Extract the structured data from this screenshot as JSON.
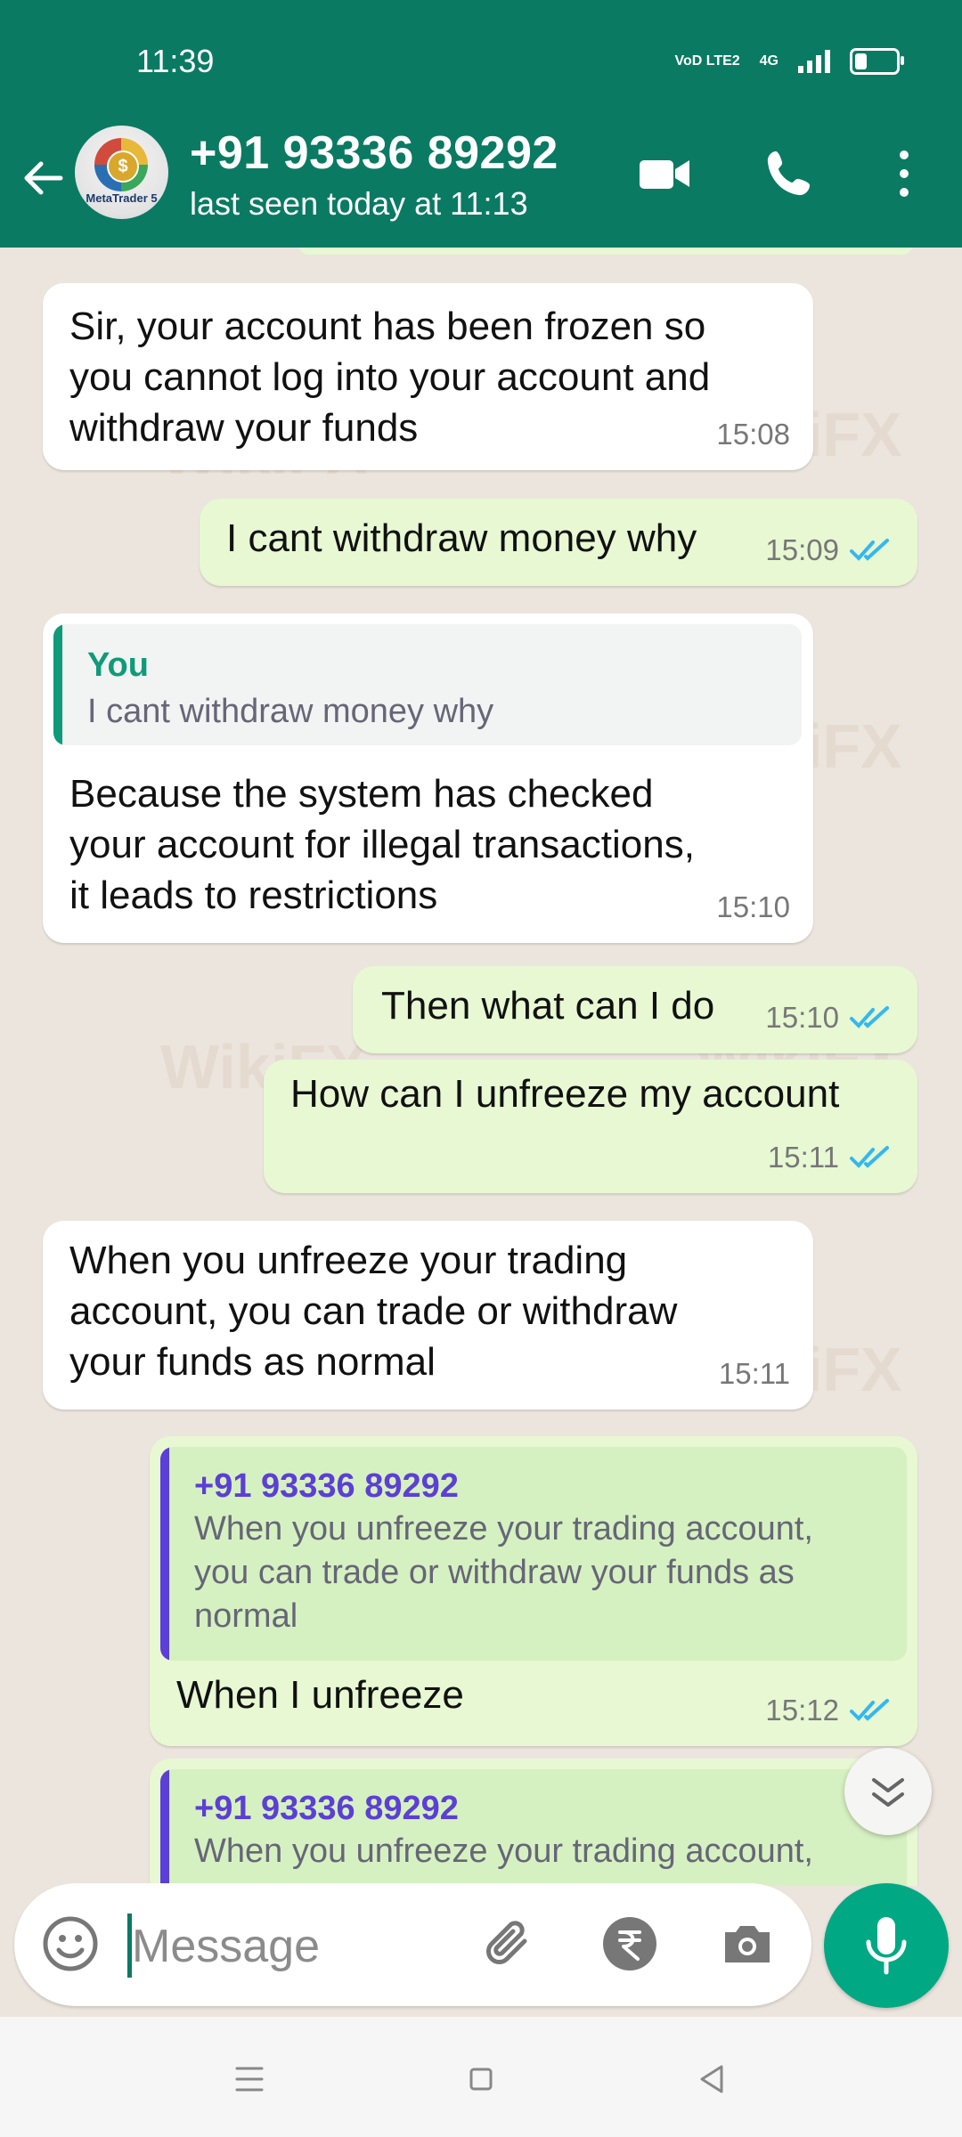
{
  "status_bar": {
    "time": "11:39",
    "network_label_1": "VoD LTE2",
    "network_label_2": "4G",
    "battery_fraction": 0.3
  },
  "header": {
    "contact_name": "+91 93336 89292",
    "last_seen": "last seen today at 11:13",
    "avatar_label": "MetaTrader 5",
    "icons": [
      "back-arrow-icon",
      "video-call-icon",
      "voice-call-icon",
      "more-options-icon"
    ]
  },
  "messages": [
    {
      "direction": "in",
      "text_lines": [
        "Sir, your account has been frozen so",
        "you cannot log into your account and",
        "withdraw your funds"
      ],
      "time": "15:08"
    },
    {
      "direction": "out",
      "text_lines": [
        "I cant withdraw money why"
      ],
      "time": "15:09",
      "status": "read"
    },
    {
      "direction": "in",
      "quote": {
        "author": "You",
        "text_lines": [
          "I cant withdraw money why"
        ]
      },
      "text_lines": [
        "Because the system has checked",
        "your account for illegal transactions,",
        "it leads to restrictions"
      ],
      "time": "15:10"
    },
    {
      "direction": "out",
      "text_lines": [
        "Then what can I do"
      ],
      "time": "15:10",
      "status": "read"
    },
    {
      "direction": "out",
      "text_lines": [
        "How can I unfreeze my account"
      ],
      "time": "15:11",
      "status": "read"
    },
    {
      "direction": "in",
      "text_lines": [
        "When you unfreeze your trading",
        "account, you can trade or withdraw",
        "your funds as normal"
      ],
      "time": "15:11"
    },
    {
      "direction": "out",
      "quote": {
        "author": "+91 93336 89292",
        "text_lines": [
          "When you unfreeze your trading account,",
          "you can trade or withdraw your funds as",
          "normal"
        ]
      },
      "text_lines": [
        "When I unfreeze"
      ],
      "time": "15:12",
      "status": "read"
    },
    {
      "direction": "out",
      "quote": {
        "author": "+91 93336 89292",
        "text_lines": [
          "When you unfreeze your trading account,"
        ]
      },
      "text_lines": [],
      "time": ""
    }
  ],
  "composer": {
    "placeholder": "Message",
    "icons": [
      "emoji-icon",
      "attach-icon",
      "rupee-payment-icon",
      "camera-icon",
      "microphone-icon"
    ]
  },
  "watermark": "WikiFX",
  "colors": {
    "header": "#0a7a63",
    "accent_green": "#00a884",
    "outgoing_bubble": "#e7f8d3",
    "incoming_bubble": "#ffffff",
    "read_ticks": "#34b7f1",
    "quote_you": "#0f9b7a",
    "quote_contact": "#5c3fd6"
  }
}
